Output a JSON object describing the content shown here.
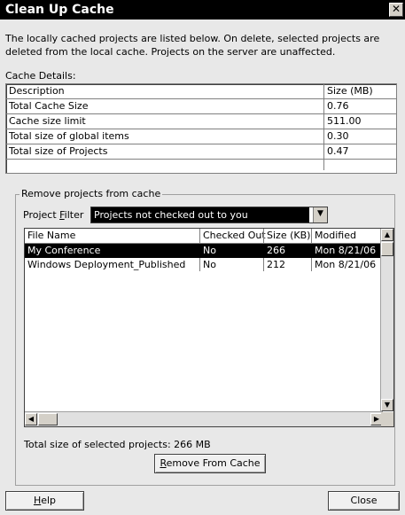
{
  "window": {
    "title": "Clean Up Cache",
    "close_glyph": "✕"
  },
  "intro": "The locally cached projects are listed below. On delete, selected projects are deleted from the local cache. Projects on the server are unaffected.",
  "cache_details": {
    "label": "Cache Details:",
    "headers": {
      "description": "Description",
      "size": "Size (MB)"
    },
    "rows": [
      {
        "description": "Total Cache Size",
        "size": "0.76"
      },
      {
        "description": "Cache size limit",
        "size": "511.00"
      },
      {
        "description": "Total size of global items",
        "size": "0.30"
      },
      {
        "description": "Total size of Projects",
        "size": "0.47"
      }
    ]
  },
  "remove_group": {
    "title": "Remove projects from cache",
    "filter_label_pre": "Project ",
    "filter_label_u": "F",
    "filter_label_post": "ilter",
    "filter_value": "Projects not checked out to you",
    "columns": {
      "file_name": "File Name",
      "checked_out": "Checked Out",
      "size": "Size (KB)",
      "modified": "Modified"
    },
    "files": [
      {
        "file_name": "My Conference",
        "checked_out": "No",
        "size": "266",
        "modified": "Mon 8/21/06",
        "selected": true
      },
      {
        "file_name": "Windows Deployment_Published",
        "checked_out": "No",
        "size": "212",
        "modified": "Mon 8/21/06",
        "selected": false
      }
    ],
    "total_selected": "Total size of selected projects: 266 MB",
    "remove_btn_u": "R",
    "remove_btn_rest": "emove From Cache"
  },
  "footer": {
    "help_u": "H",
    "help_rest": "elp",
    "close": "Close"
  },
  "icons": {
    "dropdown": "▼",
    "up": "▲",
    "down": "▼",
    "left": "◀",
    "right": "▶"
  }
}
